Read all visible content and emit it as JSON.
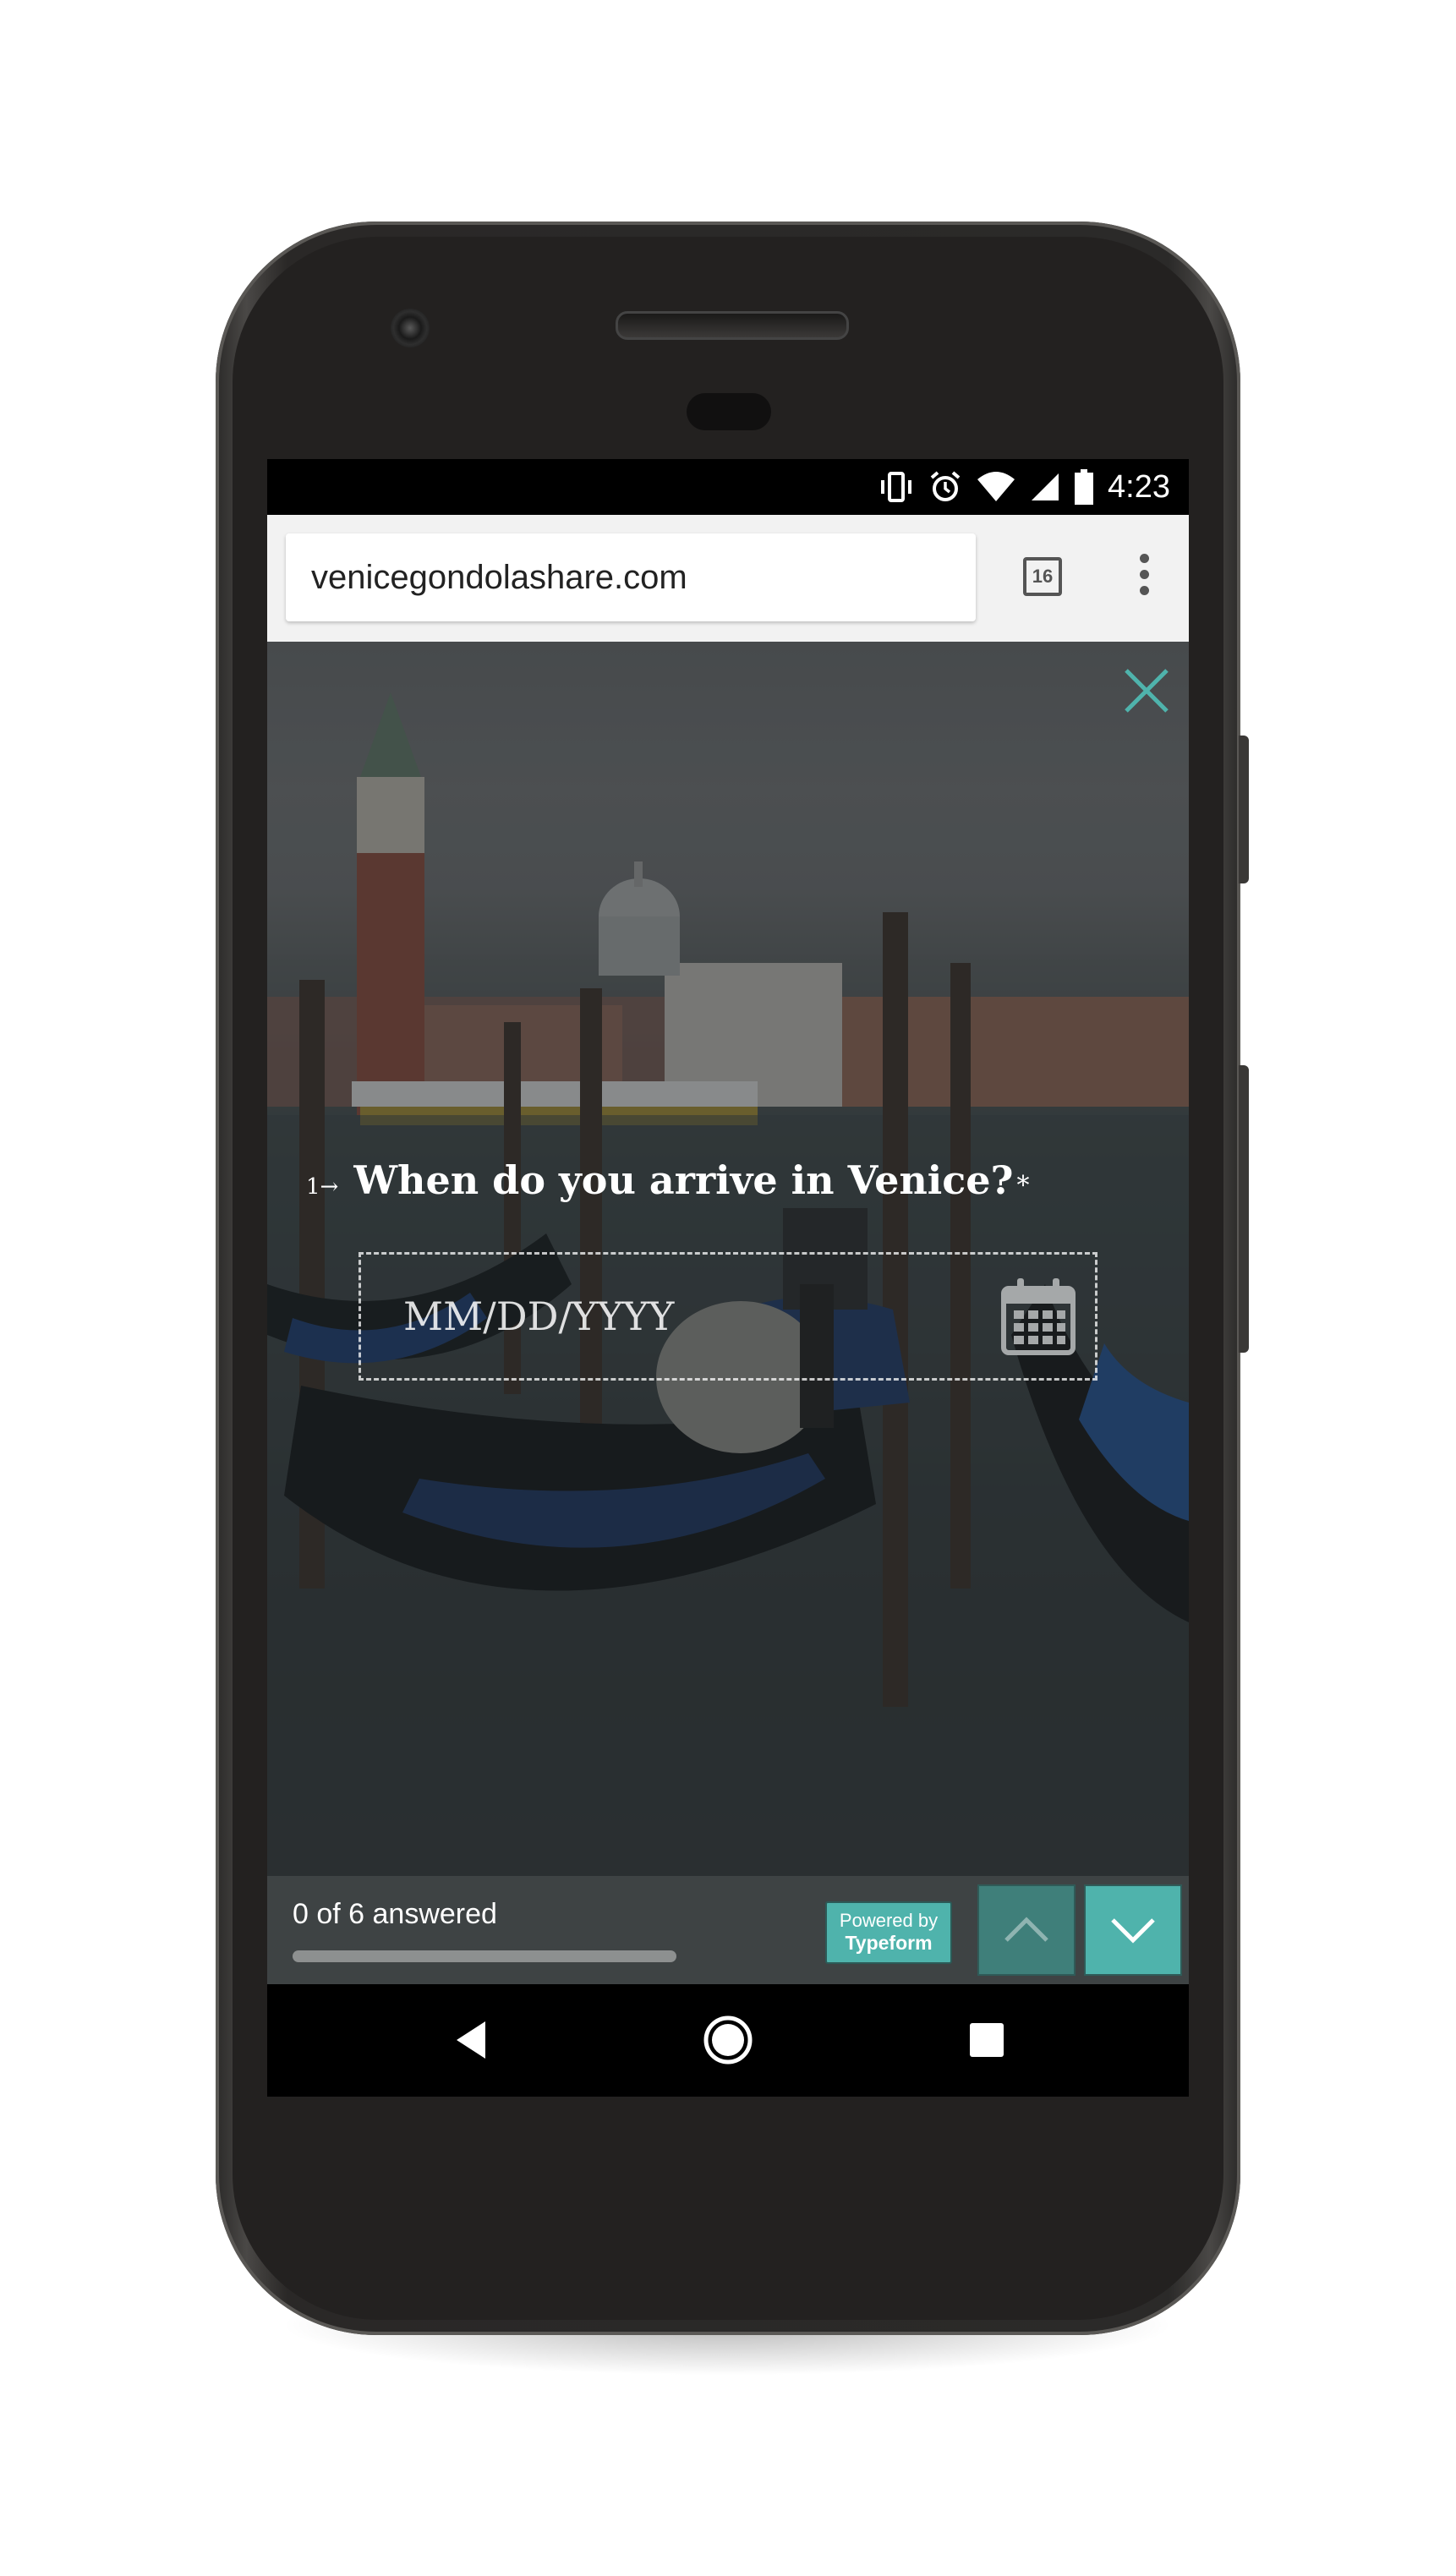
{
  "status_bar": {
    "time": "4:23",
    "icons": [
      "vibrate-icon",
      "alarm-icon",
      "wifi-icon",
      "signal-icon",
      "battery-icon"
    ]
  },
  "browser": {
    "url": "venicegondolashare.com",
    "tab_count": "16",
    "menu_icon": "more-vert-icon"
  },
  "form": {
    "question_number": "1",
    "question_arrow": "→",
    "question_text": "When do you arrive in Venice?",
    "required_marker": "*",
    "date_placeholder": "MM/DD/YYYY",
    "calendar_icon": "calendar-icon",
    "close_icon": "close-icon"
  },
  "footer": {
    "answered_text": "0 of 6 answered",
    "progress": 0,
    "powered_by_line1": "Powered by",
    "powered_by_line2": "Typeform",
    "up_icon": "chevron-up-icon",
    "down_icon": "chevron-down-icon"
  },
  "nav_bar": {
    "back_icon": "back-icon",
    "home_icon": "home-icon",
    "recents_icon": "recents-icon"
  },
  "colors": {
    "accent": "#4fb3ac",
    "accent_dark": "#3f7f7a",
    "footer_bg": "#3e4344",
    "phone_body": "#2b2a29"
  }
}
